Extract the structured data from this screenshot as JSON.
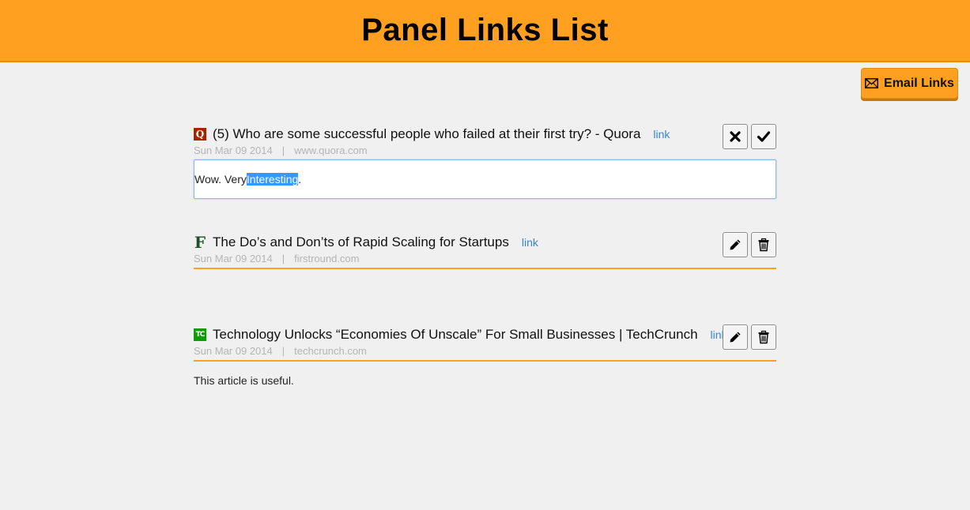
{
  "header": {
    "title": "Panel Links List"
  },
  "email_button": {
    "label": "Email Links",
    "icon": "envelope-icon"
  },
  "colors": {
    "accent": "#ffa020",
    "link": "#3a84c9",
    "meta": "#b4b4b4"
  },
  "items": [
    {
      "favicon": "Q",
      "title": "(5) Who are some successful people who failed at their first try? - Quora",
      "link_label": "link",
      "date": "Sun Mar 09 2014",
      "separator": "|",
      "domain": "www.quora.com",
      "mode": "editing",
      "note_before": "Wow. Very ",
      "note_selected": "Interesting",
      "note_after": ".",
      "actions": [
        "cancel-icon",
        "confirm-icon"
      ]
    },
    {
      "favicon": "F",
      "title": "The Do’s and Don’ts of Rapid Scaling for Startups",
      "link_label": "link",
      "date": "Sun Mar 09 2014",
      "separator": "|",
      "domain": "firstround.com",
      "mode": "view",
      "note": "",
      "actions": [
        "edit-icon",
        "delete-icon"
      ]
    },
    {
      "favicon": "TC",
      "title": "Technology Unlocks “Economies Of Unscale” For Small Businesses | TechCrunch",
      "link_label": "link",
      "date": "Sun Mar 09 2014",
      "separator": "|",
      "domain": "techcrunch.com",
      "mode": "view",
      "note": "This article is useful.",
      "actions": [
        "edit-icon",
        "delete-icon"
      ]
    }
  ]
}
